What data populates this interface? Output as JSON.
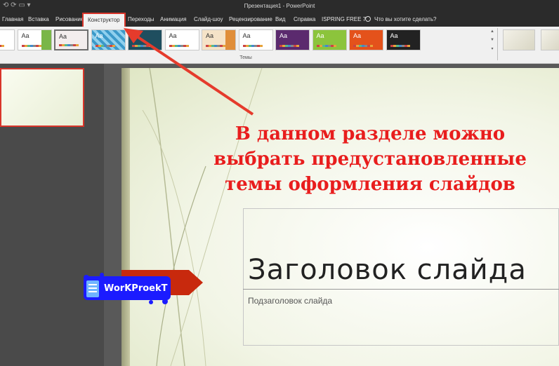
{
  "window": {
    "title": "Презентация1 - PowerPoint"
  },
  "tabs": [
    {
      "label": "Главная"
    },
    {
      "label": "Вставка"
    },
    {
      "label": "Рисование"
    },
    {
      "label": "Конструктор",
      "active": true
    },
    {
      "label": "Переходы"
    },
    {
      "label": "Анимация"
    },
    {
      "label": "Слайд-шоу"
    },
    {
      "label": "Рецензирование"
    },
    {
      "label": "Вид"
    },
    {
      "label": "Справка"
    },
    {
      "label": "ISPRING FREE 7"
    }
  ],
  "tell_me": {
    "placeholder": "Что вы хотите сделать?"
  },
  "ribbon": {
    "group_label": "Темы",
    "theme_sample": "Aa",
    "themes": [
      {
        "bg": "#ffffff",
        "fg": "#333333"
      },
      {
        "bg": "#ffffff",
        "fg": "#333333",
        "accent": "#7ab648"
      },
      {
        "bg": "#f3eded",
        "fg": "#333333",
        "selected": true
      },
      {
        "bg": "#3b99c9",
        "fg": "#ffffff",
        "pattern": true
      },
      {
        "bg": "#1f4e5f",
        "fg": "#ffffff"
      },
      {
        "bg": "#ffffff",
        "fg": "#333333"
      },
      {
        "bg": "#f5e3c8",
        "fg": "#333333",
        "accent": "#e08e3a"
      },
      {
        "bg": "#ffffff",
        "fg": "#333333"
      },
      {
        "bg": "#5b2a6e",
        "fg": "#ffffff"
      },
      {
        "bg": "#8cc43c",
        "fg": "#ffffff"
      },
      {
        "bg": "#e4521b",
        "fg": "#ffffff"
      },
      {
        "bg": "#222222",
        "fg": "#ffffff"
      }
    ]
  },
  "slide": {
    "title": "Заголовок слайда",
    "subtitle": "Подзаголовок слайда"
  },
  "annotation": {
    "lines": [
      "В данном разделе можно",
      "выбрать предустановленные",
      "темы оформления слайдов"
    ],
    "color": "#e81d1d"
  },
  "watermark": {
    "text": "WorKProekT"
  }
}
